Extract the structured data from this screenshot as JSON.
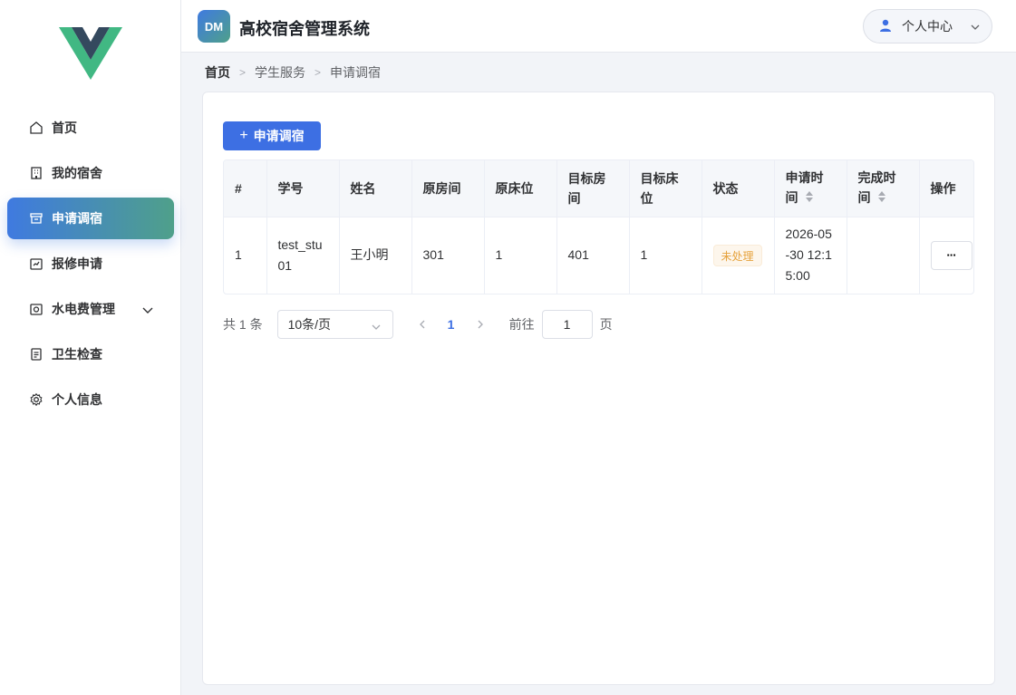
{
  "header": {
    "brand_badge": "DM",
    "title": "高校宿舍管理系统",
    "user_center_label": "个人中心"
  },
  "sidebar": {
    "items": [
      {
        "label": "首页",
        "icon": "home-icon"
      },
      {
        "label": "我的宿舍",
        "icon": "building-icon"
      },
      {
        "label": "申请调宿",
        "icon": "archive-box-icon",
        "active": true
      },
      {
        "label": "报修申请",
        "icon": "tool-box-icon"
      },
      {
        "label": "水电费管理",
        "icon": "meter-icon",
        "expandable": true
      },
      {
        "label": "卫生检查",
        "icon": "document-icon"
      },
      {
        "label": "个人信息",
        "icon": "gear-icon"
      }
    ]
  },
  "breadcrumb": {
    "items": [
      "首页",
      "学生服务",
      "申请调宿"
    ]
  },
  "main": {
    "apply_button_label": "申请调宿",
    "table": {
      "headers": [
        "#",
        "学号",
        "姓名",
        "原房间",
        "原床位",
        "目标房间",
        "目标床位",
        "状态",
        "申请时间",
        "完成时间",
        "操作"
      ],
      "rows": [
        {
          "index": "1",
          "student_id": "test_stu01",
          "name": "王小明",
          "orig_room": "301",
          "orig_bed": "1",
          "target_room": "401",
          "target_bed": "1",
          "status": "未处理",
          "apply_time": "2026-05-30 12:15:00",
          "finish_time": "",
          "action": "···"
        }
      ]
    },
    "pagination": {
      "total": "共 1 条",
      "page_size": "10条/页",
      "current_page": "1",
      "goto_label": "前往",
      "goto_value": "1",
      "page_suffix": "页"
    }
  },
  "colors": {
    "primary": "#3d6fe3",
    "accent_gradient_start": "#3f7ae0",
    "accent_gradient_end": "#4fa08a",
    "warning_text": "#e6a23c"
  }
}
